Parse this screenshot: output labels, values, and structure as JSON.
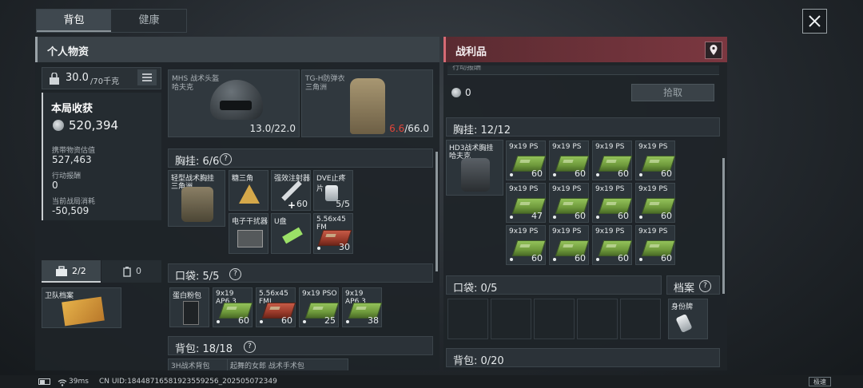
{
  "tabs": [
    "背包",
    "健康"
  ],
  "left_header": "个人物资",
  "right_header": "战利品",
  "weight": {
    "value": "30.0",
    "max": "/70千克"
  },
  "round_income": {
    "title": "本局收获",
    "value": "520,394"
  },
  "stats": [
    {
      "label": "携带物资估值",
      "value": "527,463"
    },
    {
      "label": "行动报酬",
      "value": "0"
    },
    {
      "label": "当前战局消耗",
      "value": "-50,509"
    }
  ],
  "cases": {
    "briefcase": "2/2",
    "canister": "0"
  },
  "left_item": {
    "name": "卫队档案"
  },
  "helmet": {
    "name": "MHS 战术头盔",
    "source": "哈夫克",
    "durability": "13.0/22.0"
  },
  "armor": {
    "name": "TG-H防弹衣",
    "source": "三角洲",
    "durability_low": "6.6",
    "durability_max": "/66.0"
  },
  "chest": {
    "label": "胸挂: 6/6"
  },
  "chest_items": [
    {
      "name": "轻型战术胸挂",
      "source": "三角洲"
    },
    {
      "name": "糖三角",
      "count": ""
    },
    {
      "name": "强效注射器",
      "count": "60"
    },
    {
      "name": "DVE止疼片",
      "count": "5/5"
    },
    {
      "name": "电子干扰器",
      "count": ""
    },
    {
      "name": "U盘",
      "count": ""
    },
    {
      "name": "5.56x45 FM",
      "count": "30"
    }
  ],
  "pocket": {
    "label": "口袋: 5/5"
  },
  "pocket_items": [
    {
      "name": "蛋白粉包",
      "count": ""
    },
    {
      "name": "9x19 AP6.3",
      "count": "60"
    },
    {
      "name": "5.56x45 FMJ",
      "count": "60"
    },
    {
      "name": "9x19 PSO",
      "count": "25"
    },
    {
      "name": "9x19 AP6.3",
      "count": "38"
    }
  ],
  "backpack": {
    "label": "背包: 18/18"
  },
  "backpack_items": [
    "3H战术背包",
    "起舞的女郎 战术手术包"
  ],
  "loot": {
    "value": "0",
    "pick_label": "拾取",
    "top_note": "行动报酬"
  },
  "loot_chest": {
    "label": "胸挂: 12/12",
    "rig_name": "HD3战术胸挂",
    "rig_source": "哈夫克"
  },
  "loot_ammo": [
    {
      "name": "9x19 PS",
      "count": "60"
    },
    {
      "name": "9x19 PS",
      "count": "60"
    },
    {
      "name": "9x19 PS",
      "count": "60"
    },
    {
      "name": "9x19 PS",
      "count": "60"
    },
    {
      "name": "9x19 PS",
      "count": "47"
    },
    {
      "name": "9x19 PS",
      "count": "60"
    },
    {
      "name": "9x19 PS",
      "count": "60"
    },
    {
      "name": "9x19 PS",
      "count": "60"
    },
    {
      "name": "9x19 PS",
      "count": "60"
    },
    {
      "name": "9x19 PS",
      "count": "60"
    },
    {
      "name": "9x19 PS",
      "count": "60"
    },
    {
      "name": "9x19 PS",
      "count": "60"
    }
  ],
  "loot_pocket": {
    "label": "口袋: 0/5"
  },
  "archive": {
    "label": "档案",
    "item": "身份牌"
  },
  "loot_backpack": {
    "label": "背包: 0/20"
  },
  "status": {
    "ping": "39ms",
    "uid": "CN UID:18448716581923559256_202505072349",
    "speed": "极速"
  }
}
